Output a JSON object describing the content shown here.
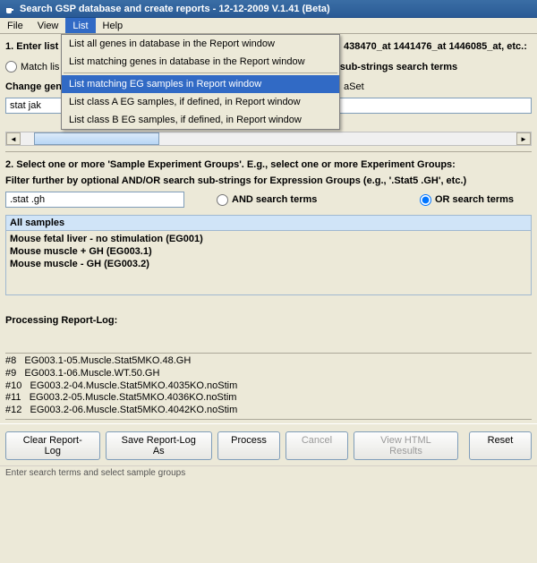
{
  "window": {
    "title": "Search GSP database and create reports - 12-12-2009 V.1.41 (Beta)"
  },
  "menubar": {
    "items": [
      "File",
      "View",
      "List",
      "Help"
    ],
    "activeIndex": 2
  },
  "dropdown": {
    "items": [
      "List all genes in database in the Report window",
      "List matching genes in database in the Report window",
      "List matching EG samples in Report window",
      "List class A EG samples, if defined, in Report window",
      "List class B EG samples, if defined, in Report window"
    ],
    "highlightIndex": 2
  },
  "step1": {
    "label_partA": "1. Enter list o",
    "label_partB": "438470_at 1441476_at 1446085_at, etc.:",
    "radio_match_visible": "Match lis",
    "radio_list_tail": "ist of sub-strings search terms",
    "change_label": "Change gene",
    "change_tail": "aSet",
    "input_value": "stat jak"
  },
  "step2": {
    "label": "2. Select one or more 'Sample Experiment Groups'. E.g., select one or more Experiment Groups:",
    "filter_label": "Filter further by optional AND/OR search sub-strings for Expression Groups (e.g., '.Stat5 .GH', etc.)",
    "filter_value": ".stat .gh",
    "and_label": "AND search terms",
    "or_label": "OR search terms",
    "or_selected": true
  },
  "samples": {
    "header": "All samples",
    "rows": [
      "Mouse fetal liver - no stimulation (EG001)",
      "Mouse muscle + GH (EG003.1)",
      "Mouse muscle - GH (EG003.2)"
    ]
  },
  "reportlog": {
    "label": "Processing Report-Log:",
    "lines": [
      "#8   EG003.1-05.Muscle.Stat5MKO.48.GH",
      "#9   EG003.1-06.Muscle.WT.50.GH",
      "#10   EG003.2-04.Muscle.Stat5MKO.4035KO.noStim",
      "#11   EG003.2-05.Muscle.Stat5MKO.4036KO.noStim",
      "#12   EG003.2-06.Muscle.Stat5MKO.4042KO.noStim"
    ]
  },
  "buttons": {
    "clear": "Clear Report-Log",
    "save": "Save Report-Log As",
    "process": "Process",
    "cancel": "Cancel",
    "viewhtml": "View HTML Results",
    "reset": "Reset"
  },
  "status": "Enter search terms and select sample groups"
}
